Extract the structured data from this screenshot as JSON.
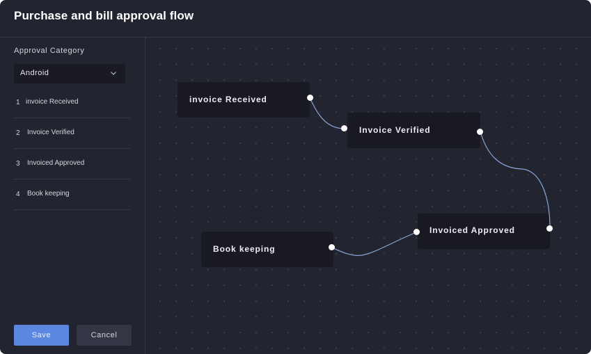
{
  "header": {
    "title": "Purchase and bill approval flow"
  },
  "sidebar": {
    "category_label": "Approval Category",
    "category_select": {
      "value": "Android",
      "icon": "chevron-down-icon"
    },
    "steps": [
      {
        "num": "1",
        "label": "invoice Received"
      },
      {
        "num": "2",
        "label": "Invoice Verified"
      },
      {
        "num": "3",
        "label": "Invoiced Approved"
      },
      {
        "num": "4",
        "label": "Book keeping"
      }
    ],
    "save_label": "Save",
    "cancel_label": "Cancel"
  },
  "flow": {
    "nodes": [
      {
        "id": "n1",
        "label": "invoice Received"
      },
      {
        "id": "n2",
        "label": "Invoice Verified"
      },
      {
        "id": "n3",
        "label": "Invoiced Approved"
      },
      {
        "id": "n4",
        "label": "Book keeping"
      }
    ],
    "edges": [
      {
        "from": "invoice Received",
        "to": "Invoice Verified"
      },
      {
        "from": "Invoice Verified",
        "to": "Invoiced Approved"
      },
      {
        "from": "Invoiced Approved",
        "to": "Book keeping"
      }
    ]
  },
  "colors": {
    "accent": "#5b87e0",
    "wire": "#8aa6d8",
    "background": "#22242f",
    "node": "#191a21"
  }
}
